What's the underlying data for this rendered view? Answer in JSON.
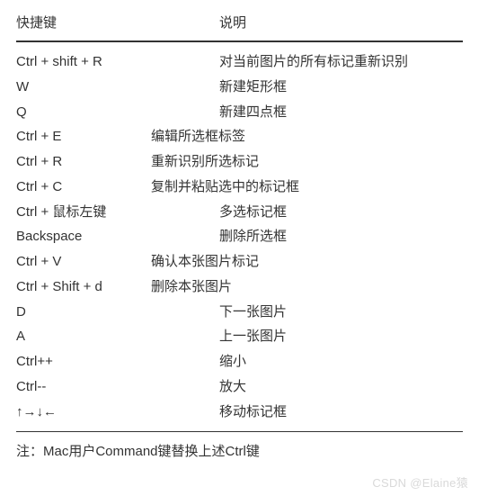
{
  "header": {
    "key": "快捷键",
    "desc": "说明"
  },
  "rows": [
    {
      "key": "Ctrl + shift + R",
      "desc": "对当前图片的所有标记重新识别",
      "w": 0
    },
    {
      "key": "W",
      "desc": "新建矩形框",
      "w": 0
    },
    {
      "key": "Q",
      "desc": "新建四点框",
      "w": 0
    },
    {
      "key": "Ctrl + E",
      "desc": "编辑所选框标签",
      "w": 1
    },
    {
      "key": "Ctrl + R",
      "desc": "重新识别所选标记",
      "w": 1
    },
    {
      "key": "Ctrl + C",
      "desc": "复制并粘贴选中的标记框",
      "w": 1
    },
    {
      "key": "Ctrl + 鼠标左键",
      "desc": "多选标记框",
      "w": 0
    },
    {
      "key": "Backspace",
      "desc": "删除所选框",
      "w": 0
    },
    {
      "key": "Ctrl + V",
      "desc": "确认本张图片标记",
      "w": 1
    },
    {
      "key": "Ctrl + Shift + d",
      "desc": "删除本张图片",
      "w": 1
    },
    {
      "key": "D",
      "desc": "下一张图片",
      "w": 0
    },
    {
      "key": "A",
      "desc": "上一张图片",
      "w": 0
    },
    {
      "key": "Ctrl++",
      "desc": "缩小",
      "w": 0
    },
    {
      "key": "Ctrl--",
      "desc": "放大",
      "w": 0
    },
    {
      "key": "↑→↓←",
      "desc": "移动标记框",
      "w": 0
    }
  ],
  "note": "注：Mac用户Command键替换上述Ctrl键",
  "watermark": "CSDN @Elaine猿"
}
